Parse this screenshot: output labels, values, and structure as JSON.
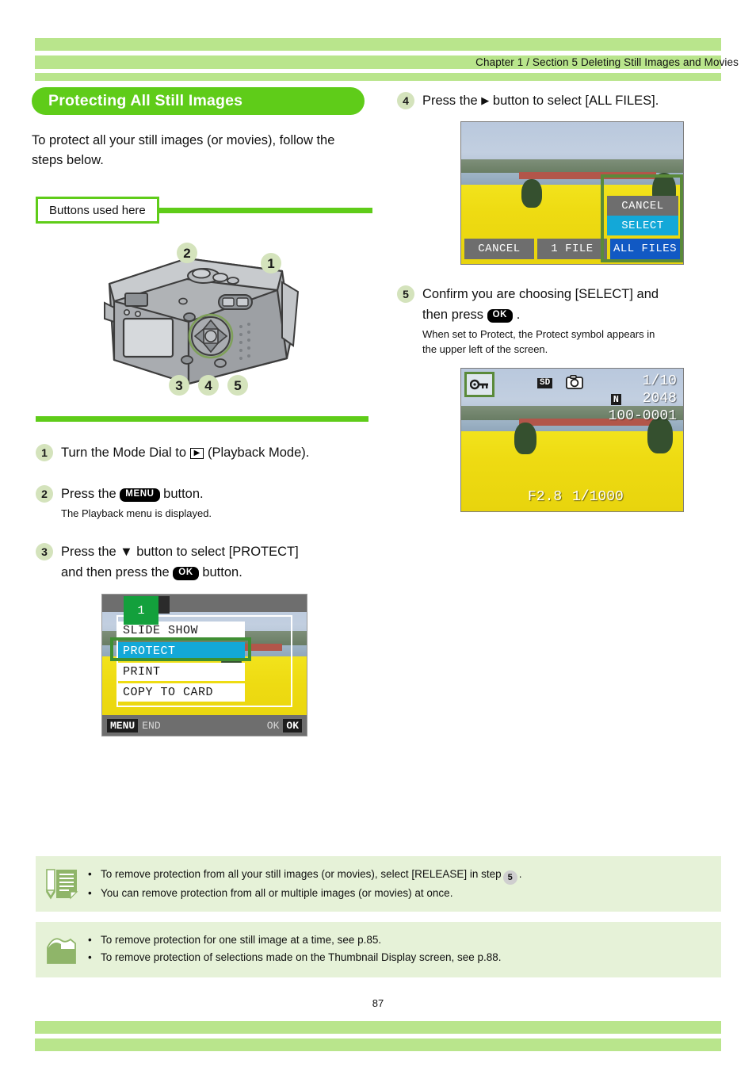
{
  "header": {
    "breadcrumb": "Chapter  1 / Section 5  Deleting Still Images and Movies"
  },
  "section": {
    "title": "Protecting All Still Images",
    "intro": "To protect all your still images (or movies), follow the steps below.",
    "buttons_used_label": "Buttons used here"
  },
  "camera_callouts": {
    "c1": "1",
    "c2": "2",
    "c3": "3",
    "c4": "4",
    "c5": "5"
  },
  "steps": [
    {
      "num": "1",
      "text_before": "Turn the Mode Dial to",
      "key": "▶",
      "text_after": "(Playback Mode)."
    },
    {
      "num": "2",
      "text_before": "Press the",
      "key": "MENU",
      "text_after": "button.",
      "sub": "The Playback menu is displayed."
    },
    {
      "num": "3",
      "line1_before": "Press the ▼ button to select [PROTECT]",
      "line2_before": "and then press the",
      "key": "OK",
      "line2_after": "button."
    },
    {
      "num": "4",
      "text_before": "Press the",
      "key": "▶",
      "text_after": "button to select [ALL FILES]."
    },
    {
      "num": "5",
      "line1": "Confirm you are choosing [SELECT] and",
      "line2_before": "then press",
      "key": "OK",
      "line2_after": ".",
      "sub1": "When set to Protect, the Protect symbol appears in",
      "sub2": "the upper left of the screen."
    }
  ],
  "lcd_menu": {
    "tab_label": "1",
    "items": [
      {
        "label": "SLIDE SHOW",
        "selected": false
      },
      {
        "label": "PROTECT",
        "selected": true
      },
      {
        "label": "PRINT",
        "selected": false
      },
      {
        "label": "COPY TO CARD",
        "selected": false
      }
    ],
    "footer_left_chip": "MENU",
    "footer_left_label": "END",
    "footer_right_label": "OK",
    "footer_right_chip": "OK"
  },
  "lcd_allfiles": {
    "bottom_buttons": [
      {
        "label": "CANCEL",
        "state": "normal"
      },
      {
        "label": "1 FILE",
        "state": "normal"
      },
      {
        "label": "ALL FILES",
        "state": "highlighted"
      }
    ],
    "popup_buttons": [
      {
        "label": "CANCEL",
        "state": "normal"
      },
      {
        "label": "SELECT",
        "state": "selected"
      }
    ]
  },
  "lcd_protected": {
    "protect_icon": "protect-key-icon",
    "card_icon": "SD",
    "mode_icon": "camera-icon",
    "frame_counter": "1/10",
    "quality_chip": "N",
    "resolution": "2048",
    "file_number": "100-0001",
    "aperture": "F2.8",
    "shutter": "1/1000"
  },
  "notes": [
    {
      "icon": "memo-pencil-icon",
      "lines": [
        {
          "pre": "To remove protection from all your still images (or movies), select [RELEASE] in step",
          "chip": "5",
          "post": "."
        },
        {
          "pre": "You can remove protection from all or multiple images (or movies) at once."
        }
      ]
    },
    {
      "icon": "folder-icon",
      "lines": [
        {
          "pre": "To remove protection for one still image at a time, see p.85."
        },
        {
          "pre": "To remove protection of selections made on the Thumbnail Display screen, see p.88."
        }
      ]
    }
  ],
  "footer": {
    "page_number": "87"
  },
  "colors": {
    "band_green": "#b9e58c",
    "accent_green": "#5fcc19",
    "note_bg": "#e6f2d8",
    "badge_green": "#d4e3bc",
    "lcd_select_cyan": "#13a8d8",
    "lcd_blue": "#1159c4"
  }
}
